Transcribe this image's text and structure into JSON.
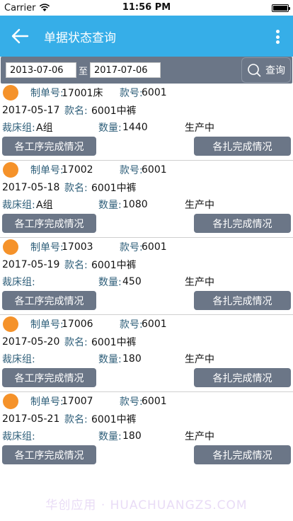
{
  "status": {
    "carrier": "Carrier",
    "time": "11:56 PM"
  },
  "header": {
    "title": "单据状态查询"
  },
  "filter": {
    "start_date": "2013-07-06",
    "separator": "至",
    "end_date": "2017-07-06",
    "search_label": "查询"
  },
  "labels": {
    "order_no": "制单号:",
    "style_no": "款号:",
    "style_name": "款名:",
    "cut_group": "裁床组:",
    "quantity": "数量:",
    "process_btn": "各工序完成情况",
    "bundle_btn": "各扎完成情况"
  },
  "orders": [
    {
      "order_no": "17001床",
      "style_no": "6001",
      "date": "2017-05-17",
      "style_name": "6001中裤",
      "cut_group": "A组",
      "quantity": "1440",
      "status": "生产中"
    },
    {
      "order_no": "17002",
      "style_no": "6001",
      "date": "2017-05-18",
      "style_name": "6001中裤",
      "cut_group": "A组",
      "quantity": "1080",
      "status": "生产中"
    },
    {
      "order_no": "17003",
      "style_no": "6001",
      "date": "2017-05-19",
      "style_name": "6001中裤",
      "cut_group": "",
      "quantity": "450",
      "status": "生产中"
    },
    {
      "order_no": "17006",
      "style_no": "6001",
      "date": "2017-05-20",
      "style_name": "6001中裤",
      "cut_group": "",
      "quantity": "180",
      "status": "生产中"
    },
    {
      "order_no": "17007",
      "style_no": "6001",
      "date": "2017-05-21",
      "style_name": "6001中裤",
      "cut_group": "",
      "quantity": "180",
      "status": "生产中"
    }
  ],
  "watermark": "华创应用 · HUACHUANGZS.COM",
  "colors": {
    "header": "#36aee8",
    "button": "#6b7687",
    "dot": "#f5922a"
  }
}
